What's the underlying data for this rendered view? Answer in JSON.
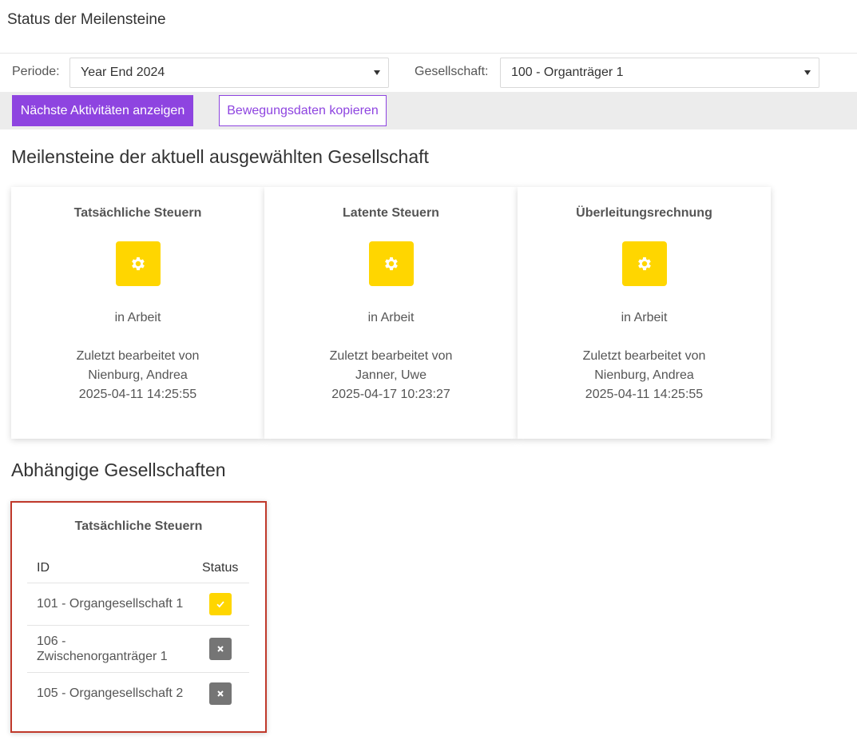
{
  "page": {
    "title": "Status der Meilensteine"
  },
  "filters": {
    "period_label": "Periode:",
    "period_value": "Year End 2024",
    "company_label": "Gesellschaft:",
    "company_value": "100 - Organträger 1"
  },
  "toolbar": {
    "next_activities_label": "Nächste Aktivitäten anzeigen",
    "copy_data_label": "Bewegungsdaten kopieren"
  },
  "milestones": {
    "heading": "Meilensteine der aktuell ausgewählten Gesellschaft",
    "cards": [
      {
        "title": "Tatsächliche Steuern",
        "icon": "gear-icon",
        "status": "in Arbeit",
        "editor_label": "Zuletzt bearbeitet von",
        "editor": "Nienburg, Andrea",
        "timestamp": "2025-04-11 14:25:55"
      },
      {
        "title": "Latente Steuern",
        "icon": "gear-icon",
        "status": "in Arbeit",
        "editor_label": "Zuletzt bearbeitet von",
        "editor": "Janner, Uwe",
        "timestamp": "2025-04-17 10:23:27"
      },
      {
        "title": "Überleitungsrechnung",
        "icon": "gear-icon",
        "status": "in Arbeit",
        "editor_label": "Zuletzt bearbeitet von",
        "editor": "Nienburg, Andrea",
        "timestamp": "2025-04-11 14:25:55"
      }
    ]
  },
  "dependent": {
    "heading": "Abhängige Gesellschaften",
    "panel_title": "Tatsächliche Steuern",
    "columns": [
      "ID",
      "Status"
    ],
    "rows": [
      {
        "id": "101 - Organgesellschaft 1",
        "status": "done",
        "icon": "check-icon"
      },
      {
        "id": "106 - Zwischenorganträger 1",
        "status": "not-done",
        "icon": "close-icon"
      },
      {
        "id": "105 - Organgesellschaft 2",
        "status": "not-done",
        "icon": "close-icon"
      }
    ]
  },
  "colors": {
    "accent": "#8e44e0",
    "status_yellow": "#ffd600",
    "status_grey": "#757575",
    "highlight_border": "#c0392b"
  }
}
